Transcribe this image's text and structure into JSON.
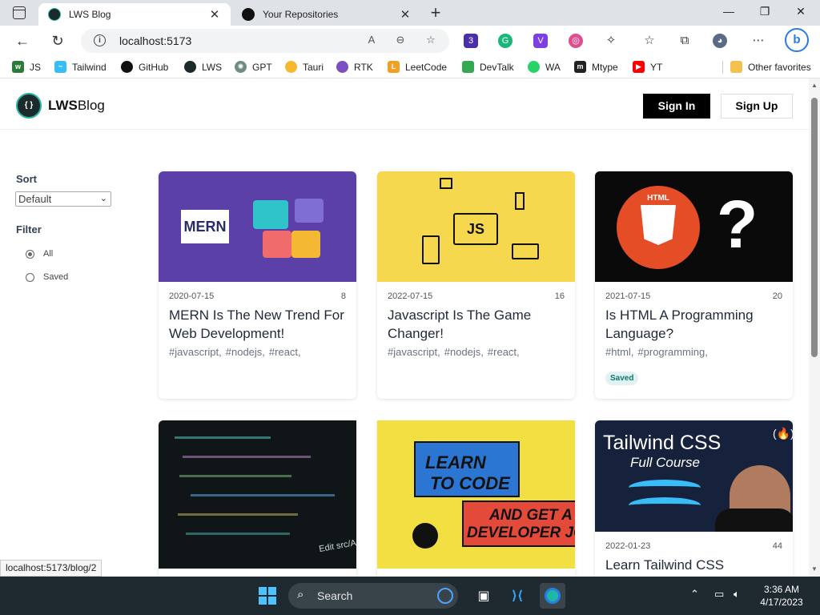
{
  "browser": {
    "tabs": [
      {
        "title": "LWS Blog",
        "active": true,
        "icon": "lws-favicon"
      },
      {
        "title": "Your Repositories",
        "active": false,
        "icon": "github-favicon"
      }
    ],
    "url": "localhost:5173",
    "extension_badge": "3",
    "favorites": [
      {
        "label": "JS",
        "icon": "w3-icon",
        "color": "#2b7a3a"
      },
      {
        "label": "Tailwind",
        "icon": "tailwind-icon",
        "color": "#38bdf8"
      },
      {
        "label": "GitHub",
        "icon": "github-icon",
        "color": "#111111"
      },
      {
        "label": "LWS",
        "icon": "lws-icon",
        "color": "#1d2a2b"
      },
      {
        "label": "GPT",
        "icon": "gpt-icon",
        "color": "#6e8c84"
      },
      {
        "label": "Tauri",
        "icon": "tauri-icon",
        "color": "#f5b82e"
      },
      {
        "label": "RTK",
        "icon": "rtk-icon",
        "color": "#7c4ec4"
      },
      {
        "label": "LeetCode",
        "icon": "leetcode-icon",
        "color": "#f0a024"
      },
      {
        "label": "DevTalk",
        "icon": "devtalk-icon",
        "color": "#34a853"
      },
      {
        "label": "WA",
        "icon": "whatsapp-icon",
        "color": "#25d366"
      },
      {
        "label": "Mtype",
        "icon": "mtype-icon",
        "color": "#222222"
      },
      {
        "label": "YT",
        "icon": "youtube-icon",
        "color": "#ff0000"
      }
    ],
    "other_favorites": "Other favorites",
    "status_url": "localhost:5173/blog/2"
  },
  "site": {
    "logo_bold": "LWS",
    "logo_rest": "Blog",
    "signin": "Sign In",
    "signup": "Sign Up"
  },
  "sidebar": {
    "sort_title": "Sort",
    "sort_value": "Default",
    "filter_title": "Filter",
    "filters": [
      {
        "label": "All",
        "checked": true
      },
      {
        "label": "Saved",
        "checked": false
      }
    ]
  },
  "posts": [
    {
      "date": "2020-07-15",
      "likes": "8",
      "title": "MERN Is The New Trend For Web Development!",
      "tags": [
        "#javascript,",
        "#nodejs,",
        "#react,"
      ],
      "saved": false,
      "thumb_text": "MERN"
    },
    {
      "date": "2022-07-15",
      "likes": "16",
      "title": "Javascript Is The Game Changer!",
      "tags": [
        "#javascript,",
        "#nodejs,",
        "#react,"
      ],
      "saved": false,
      "thumb_text": "JS"
    },
    {
      "date": "2021-07-15",
      "likes": "20",
      "title": "Is HTML A Programming Language?",
      "tags": [
        "#html,",
        "#programming,"
      ],
      "saved": true,
      "saved_label": "Saved",
      "thumb_text": "HTML"
    },
    {
      "thumb_text": "Edit src/App"
    },
    {
      "thumb_text_1": "LEARN",
      "thumb_text_2": "TO CODE",
      "thumb_text_3": "AND GET A",
      "thumb_text_4": "DEVELOPER JOB"
    },
    {
      "date": "2022-01-23",
      "likes": "44",
      "title": "Learn Tailwind CSS",
      "thumb_text_1": "Tailwind CSS",
      "thumb_text_2": "Full Course"
    }
  ],
  "taskbar": {
    "search_label": "Search",
    "time": "3:36 AM",
    "date": "4/17/2023"
  }
}
